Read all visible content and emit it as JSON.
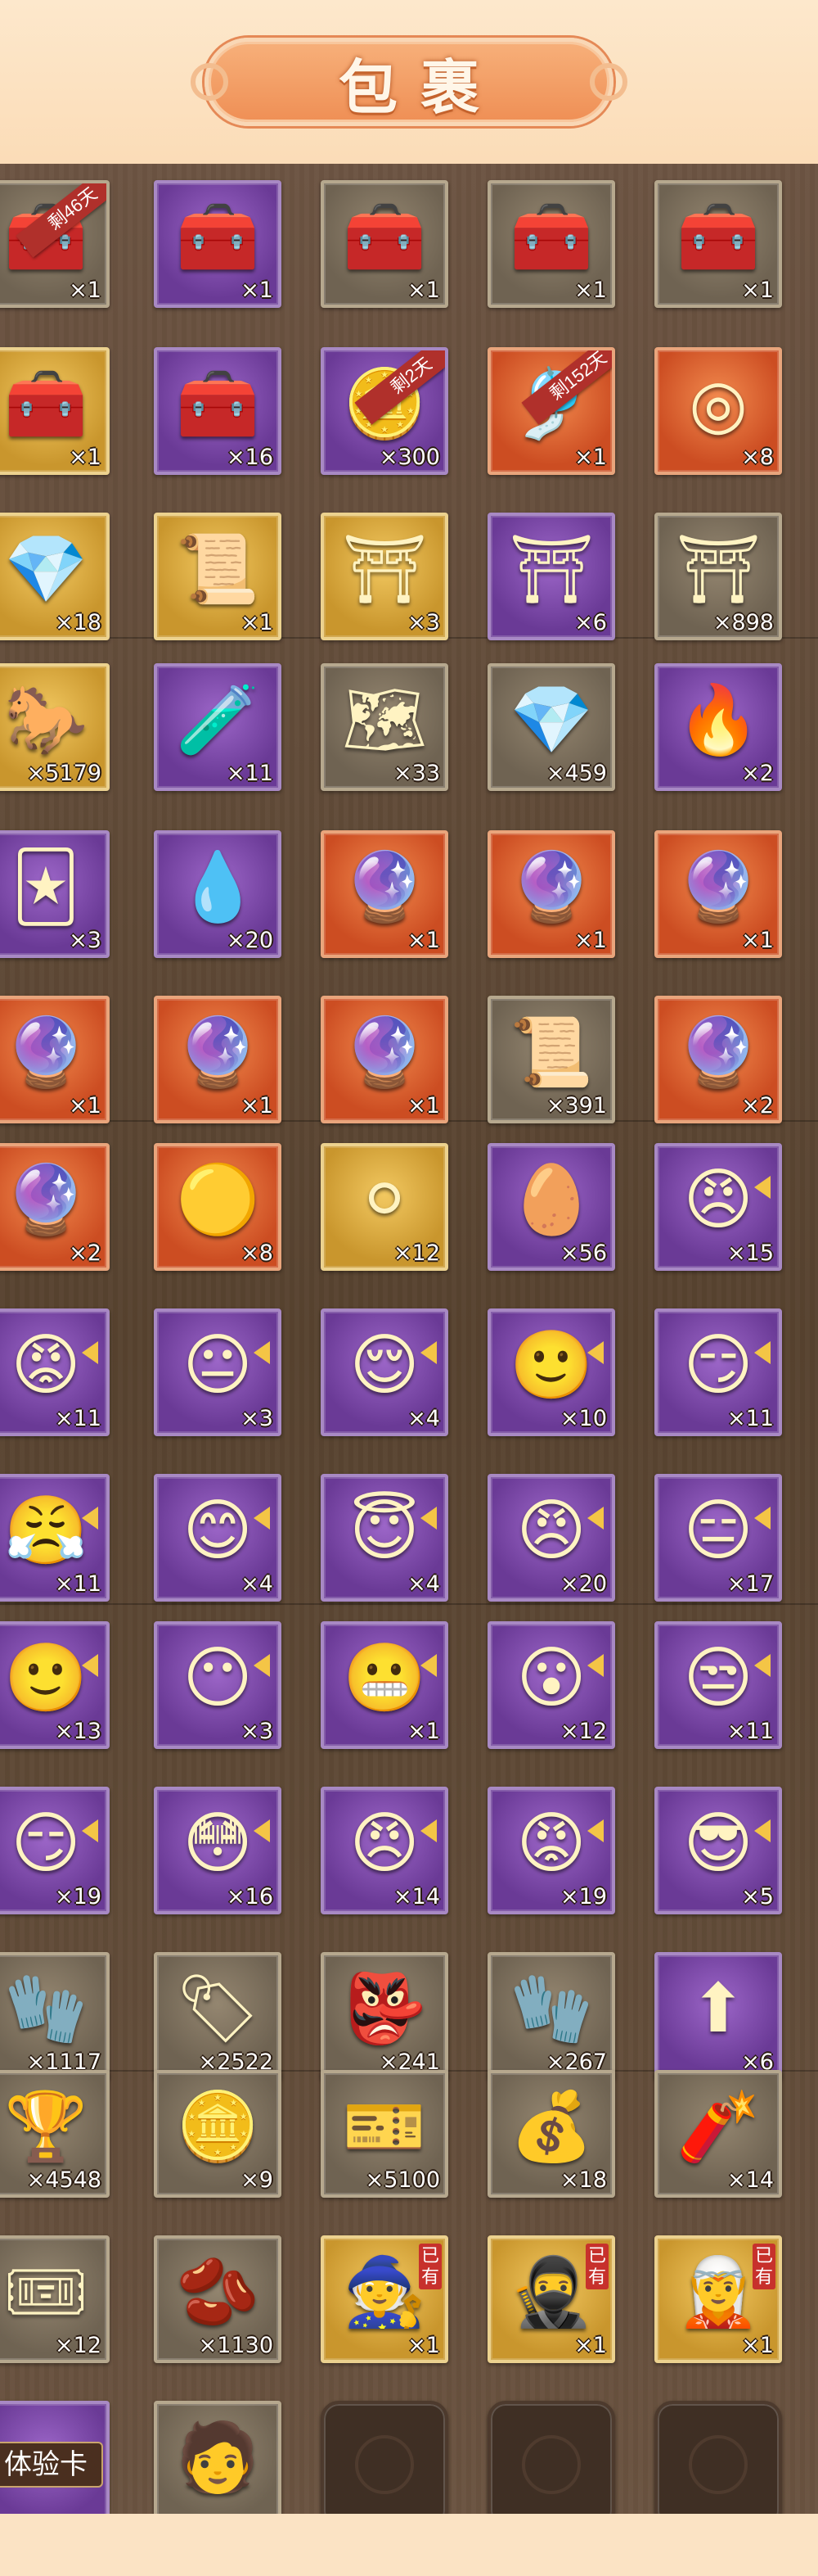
{
  "header": {
    "title": "包裹"
  },
  "inventory": [
    {
      "icon": "red-gift-chest-icon",
      "glyph": "🧰",
      "quality": "gray",
      "count": "×1",
      "ribbon": "剩46天"
    },
    {
      "icon": "purple-treasure-chest-icon",
      "glyph": "🧰",
      "quality": "purple",
      "count": "×1"
    },
    {
      "icon": "silver-chest-icon",
      "glyph": "🧰",
      "quality": "gray",
      "count": "×1"
    },
    {
      "icon": "gold-treasure-chest-icon",
      "glyph": "🧰",
      "quality": "gray",
      "count": "×1"
    },
    {
      "icon": "blue-iron-chest-icon",
      "glyph": "🧰",
      "quality": "gray",
      "count": "×1"
    },
    {
      "icon": "red-lacquer-chest-icon",
      "glyph": "🧰",
      "quality": "gold",
      "count": "×1"
    },
    {
      "icon": "purple-box-icon",
      "glyph": "🧰",
      "quality": "purple",
      "count": "×16"
    },
    {
      "icon": "red-coin-token-icon",
      "glyph": "🪙",
      "quality": "purple",
      "count": "×300",
      "ribbon": "剩2天"
    },
    {
      "icon": "golden-charm-icon",
      "glyph": "🎐",
      "quality": "orange",
      "count": "×1",
      "ribbon": "剩152天"
    },
    {
      "icon": "green-jade-ring-icon",
      "glyph": "◎",
      "quality": "orange",
      "count": "×8"
    },
    {
      "icon": "blue-crystal-icon",
      "glyph": "💎",
      "quality": "gold",
      "count": "×18"
    },
    {
      "icon": "golden-scroll-card-icon",
      "glyph": "📜",
      "quality": "gold",
      "count": "×1"
    },
    {
      "icon": "red-armor-stand-icon",
      "glyph": "⛩",
      "quality": "gold",
      "count": "×3"
    },
    {
      "icon": "silver-armor-stand-icon",
      "glyph": "⛩",
      "quality": "purple",
      "count": "×6"
    },
    {
      "icon": "green-armor-stand-icon",
      "glyph": "⛩",
      "quality": "gray",
      "count": "×898"
    },
    {
      "icon": "horse-emblem-icon",
      "glyph": "🐎",
      "quality": "gold",
      "count": "×5179"
    },
    {
      "icon": "green-gourd-icon",
      "glyph": "🧪",
      "quality": "purple",
      "count": "×11"
    },
    {
      "icon": "map-fragment-icon",
      "glyph": "🗺",
      "quality": "gray",
      "count": "×33"
    },
    {
      "icon": "blue-gem-icon",
      "glyph": "💎",
      "quality": "gray",
      "count": "×459"
    },
    {
      "icon": "flame-badge-icon",
      "glyph": "🔥",
      "quality": "purple",
      "count": "×2"
    },
    {
      "icon": "golden-cards-icon",
      "glyph": "🃏",
      "quality": "purple",
      "count": "×3"
    },
    {
      "icon": "blue-spirit-flame-icon",
      "glyph": "💧",
      "quality": "purple",
      "count": "×20"
    },
    {
      "icon": "hero-orb-woman-icon",
      "glyph": "🔮",
      "quality": "orange",
      "count": "×1"
    },
    {
      "icon": "hero-orb-warrior-icon",
      "glyph": "🔮",
      "quality": "orange",
      "count": "×1"
    },
    {
      "icon": "hero-orb-lady-icon",
      "glyph": "🔮",
      "quality": "orange",
      "count": "×1"
    },
    {
      "icon": "hero-orb-masked-icon",
      "glyph": "🔮",
      "quality": "orange",
      "count": "×1"
    },
    {
      "icon": "hero-orb-general-icon",
      "glyph": "🔮",
      "quality": "orange",
      "count": "×1"
    },
    {
      "icon": "hero-orb-maiden-icon",
      "glyph": "🔮",
      "quality": "orange",
      "count": "×1"
    },
    {
      "icon": "scroll-fragment-icon",
      "glyph": "📜",
      "quality": "gray",
      "count": "×391"
    },
    {
      "icon": "hero-orb-green-icon",
      "glyph": "🔮",
      "quality": "orange",
      "count": "×2"
    },
    {
      "icon": "hero-orb-girl-icon",
      "glyph": "🔮",
      "quality": "orange",
      "count": "×2"
    },
    {
      "icon": "golden-pearl-icon",
      "glyph": "🟡",
      "quality": "orange",
      "count": "×8"
    },
    {
      "icon": "white-pearl-icon",
      "glyph": "⚪",
      "quality": "gold",
      "count": "×12"
    },
    {
      "icon": "gold-ingot-icon",
      "glyph": "🥚",
      "quality": "purple",
      "count": "×56"
    },
    {
      "icon": "hero-shard-icon",
      "glyph": "😠",
      "quality": "purple",
      "count": "×15",
      "shard": true
    },
    {
      "icon": "hero-shard-icon",
      "glyph": "😡",
      "quality": "purple",
      "count": "×11",
      "shard": true
    },
    {
      "icon": "hero-shard-icon",
      "glyph": "😐",
      "quality": "purple",
      "count": "×3",
      "shard": true
    },
    {
      "icon": "hero-shard-icon",
      "glyph": "😌",
      "quality": "purple",
      "count": "×4",
      "shard": true
    },
    {
      "icon": "hero-shard-icon",
      "glyph": "🙂",
      "quality": "purple",
      "count": "×10",
      "shard": true
    },
    {
      "icon": "hero-shard-icon",
      "glyph": "😏",
      "quality": "purple",
      "count": "×11",
      "shard": true
    },
    {
      "icon": "hero-shard-icon",
      "glyph": "😤",
      "quality": "purple",
      "count": "×11",
      "shard": true
    },
    {
      "icon": "hero-shard-icon",
      "glyph": "😊",
      "quality": "purple",
      "count": "×4",
      "shard": true
    },
    {
      "icon": "hero-shard-icon",
      "glyph": "😇",
      "quality": "purple",
      "count": "×4",
      "shard": true
    },
    {
      "icon": "hero-shard-icon",
      "glyph": "😠",
      "quality": "purple",
      "count": "×20",
      "shard": true
    },
    {
      "icon": "hero-shard-icon",
      "glyph": "😑",
      "quality": "purple",
      "count": "×17",
      "shard": true
    },
    {
      "icon": "hero-shard-icon",
      "glyph": "🙂",
      "quality": "purple",
      "count": "×13",
      "shard": true
    },
    {
      "icon": "hero-shard-icon",
      "glyph": "😶",
      "quality": "purple",
      "count": "×3",
      "shard": true
    },
    {
      "icon": "hero-shard-icon",
      "glyph": "😬",
      "quality": "purple",
      "count": "×1",
      "shard": true
    },
    {
      "icon": "hero-shard-icon",
      "glyph": "😮",
      "quality": "purple",
      "count": "×12",
      "shard": true
    },
    {
      "icon": "hero-shard-icon",
      "glyph": "😒",
      "quality": "purple",
      "count": "×11",
      "shard": true
    },
    {
      "icon": "hero-shard-icon",
      "glyph": "😏",
      "quality": "purple",
      "count": "×19",
      "shard": true
    },
    {
      "icon": "hero-shard-icon",
      "glyph": "😳",
      "quality": "purple",
      "count": "×16",
      "shard": true
    },
    {
      "icon": "hero-shard-icon",
      "glyph": "😠",
      "quality": "purple",
      "count": "×14",
      "shard": true
    },
    {
      "icon": "hero-shard-icon",
      "glyph": "😡",
      "quality": "purple",
      "count": "×19",
      "shard": true
    },
    {
      "icon": "hero-shard-icon",
      "glyph": "😎",
      "quality": "purple",
      "count": "×5",
      "shard": true
    },
    {
      "icon": "golden-gauntlet-icon",
      "glyph": "🧤",
      "quality": "gray",
      "count": "×1117"
    },
    {
      "icon": "jade-token-icon",
      "glyph": "🏷",
      "quality": "gray",
      "count": "×2522"
    },
    {
      "icon": "opera-mask-icon",
      "glyph": "👺",
      "quality": "gray",
      "count": "×241"
    },
    {
      "icon": "bronze-gauntlet-icon",
      "glyph": "🧤",
      "quality": "gray",
      "count": "×267"
    },
    {
      "icon": "green-arrow-orb-icon",
      "glyph": "⬆",
      "quality": "purple",
      "count": "×6"
    },
    {
      "icon": "gold-trophy-coin-icon",
      "glyph": "🏆",
      "quality": "gray",
      "count": "×4548"
    },
    {
      "icon": "gold-sword-coin-icon",
      "glyph": "🪙",
      "quality": "gray",
      "count": "×9"
    },
    {
      "icon": "gold-ticket-icon",
      "glyph": "🎫",
      "quality": "gray",
      "count": "×5100"
    },
    {
      "icon": "lucky-bag-icon",
      "glyph": "💰",
      "quality": "gray",
      "count": "×18"
    },
    {
      "icon": "firecracker-icon",
      "glyph": "🧨",
      "quality": "gray",
      "count": "×14"
    },
    {
      "icon": "blue-scroll-token-icon",
      "glyph": "🎟",
      "quality": "gray",
      "count": "×12"
    },
    {
      "icon": "gold-bean-icon",
      "glyph": "🫘",
      "quality": "gray",
      "count": "×1130"
    },
    {
      "icon": "hero-portrait-elder-icon",
      "glyph": "🧙",
      "quality": "gold",
      "count": "×1",
      "owned": "已有"
    },
    {
      "icon": "hero-portrait-warrior-icon",
      "glyph": "🥷",
      "quality": "gold",
      "count": "×1",
      "owned": "已有"
    },
    {
      "icon": "hero-portrait-scholar-icon",
      "glyph": "🧝",
      "quality": "gold",
      "count": "×1",
      "owned": "已有"
    },
    {
      "icon": "trial-card-icon",
      "glyph": "",
      "quality": "purple",
      "count": "",
      "card_label": "体验卡"
    },
    {
      "icon": "hero-shard-icon",
      "glyph": "🧑",
      "quality": "gray",
      "count": ""
    },
    {
      "icon": "empty-slot-icon",
      "glyph": "",
      "quality": "empty",
      "count": ""
    },
    {
      "icon": "empty-slot-icon",
      "glyph": "",
      "quality": "empty",
      "count": ""
    },
    {
      "icon": "empty-slot-icon",
      "glyph": "",
      "quality": "empty",
      "count": ""
    }
  ]
}
